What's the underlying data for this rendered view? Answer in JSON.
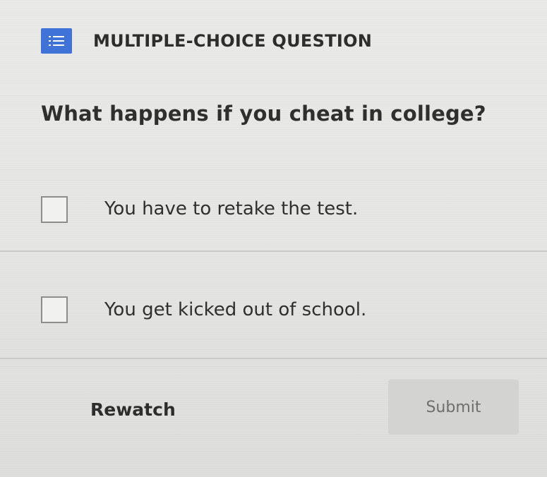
{
  "header": {
    "icon": "list-icon",
    "title": "MULTIPLE-CHOICE QUESTION"
  },
  "question": {
    "text": "What happens if you cheat in college?"
  },
  "options": [
    {
      "label": "You have to retake the test.",
      "checked": false
    },
    {
      "label": "You get kicked out of school.",
      "checked": false
    }
  ],
  "actions": {
    "rewatch_label": "Rewatch",
    "submit_label": "Submit"
  },
  "colors": {
    "header_icon_bg": "#3f73d8",
    "submit_bg": "#d3d3d1",
    "submit_text": "#6e6e6e"
  }
}
